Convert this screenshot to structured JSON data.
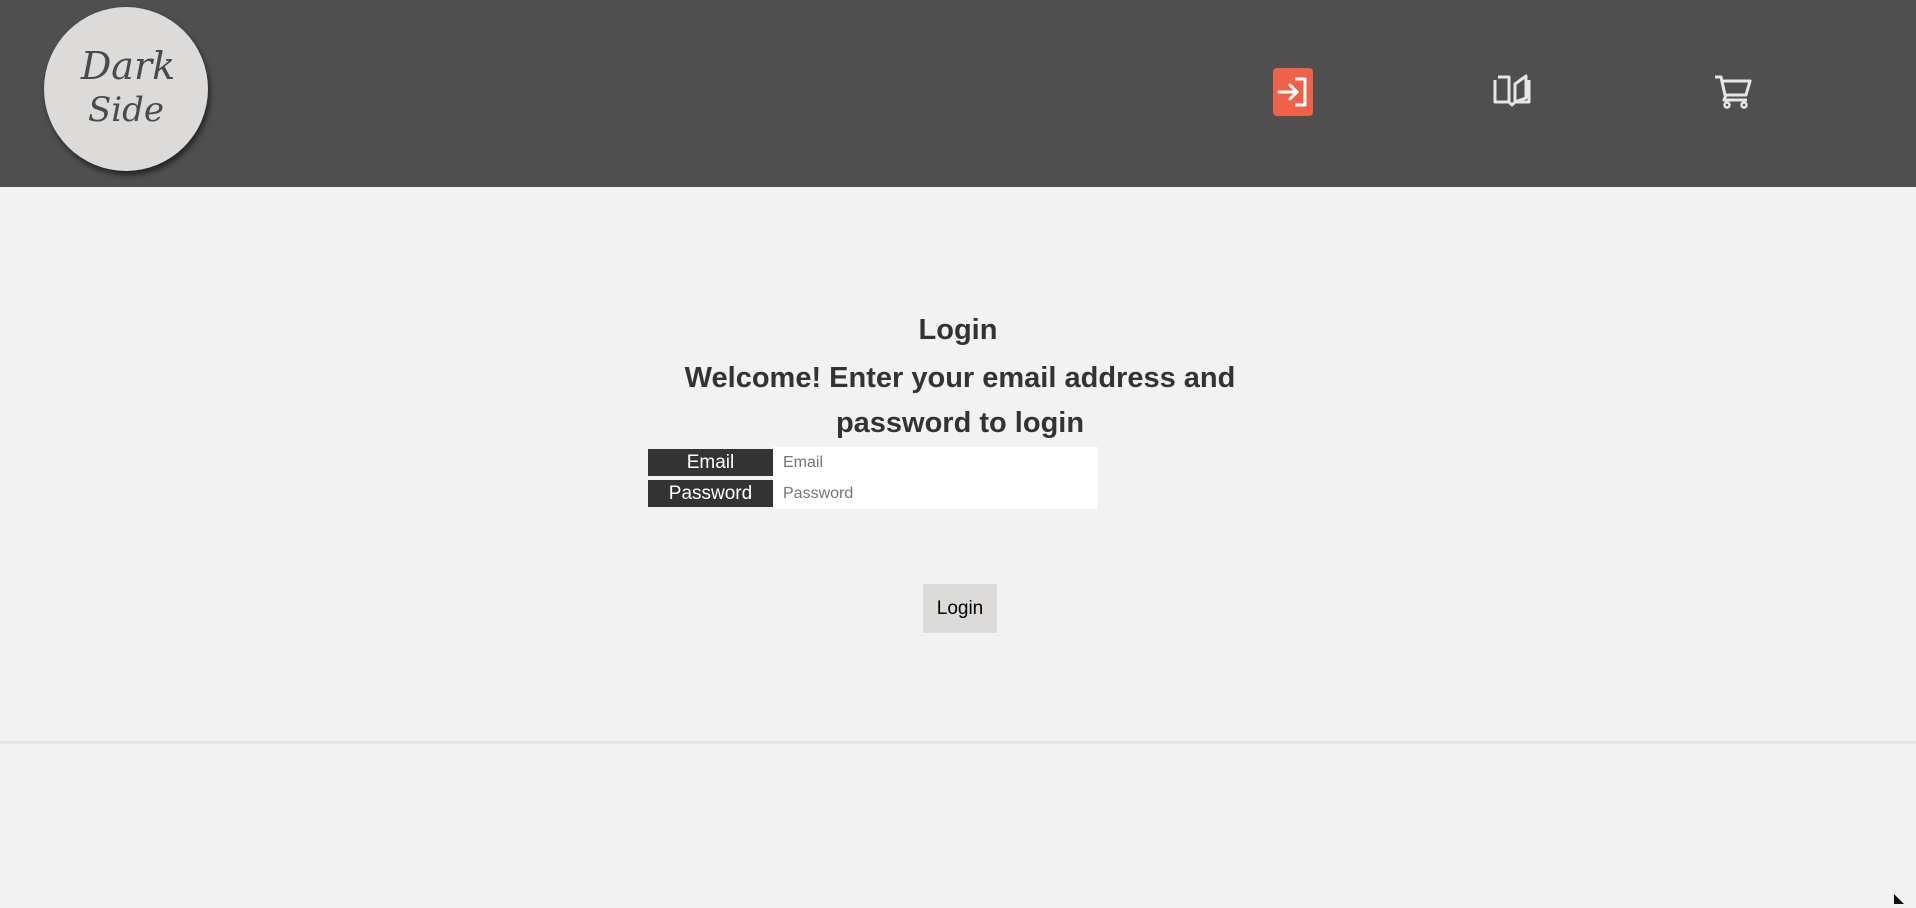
{
  "header": {
    "logo": {
      "line1": "Dark",
      "line2": "Side"
    },
    "nav": [
      {
        "icon": "login-icon",
        "active": true
      },
      {
        "icon": "book-open-icon",
        "active": false
      },
      {
        "icon": "cart-icon",
        "active": false
      }
    ]
  },
  "main": {
    "title": "Login",
    "subtitle": "Welcome! Enter your email address and password to login",
    "email_label": "Email",
    "email_placeholder": "Email",
    "email_value": "",
    "password_label": "Password",
    "password_placeholder": "Password",
    "password_value": "",
    "login_button": "Login"
  },
  "colors": {
    "header_bg": "#4f4f4f",
    "accent": "#f0614a",
    "page_bg": "#f2f2f2",
    "label_bg": "#333333",
    "text": "#333333"
  }
}
